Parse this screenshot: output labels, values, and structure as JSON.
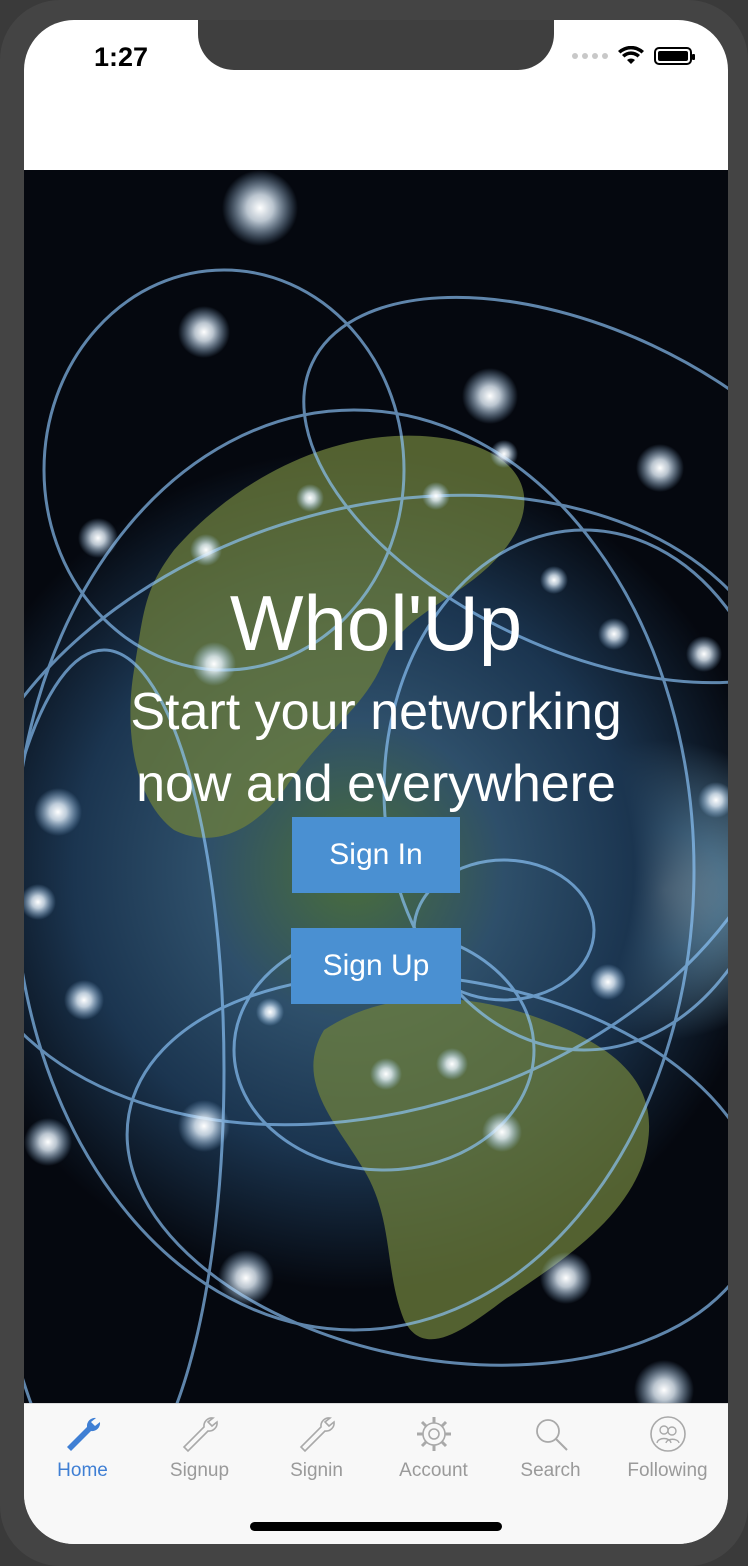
{
  "status_bar": {
    "time": "1:27"
  },
  "hero": {
    "title": "Whol'Up",
    "subtitle_line1": "Start your networking",
    "subtitle_line2": "now and everywhere",
    "signin_label": "Sign In",
    "signup_label": "Sign Up"
  },
  "tabs": [
    {
      "label": "Home",
      "icon": "wrench-icon",
      "active": true
    },
    {
      "label": "Signup",
      "icon": "wrench-icon",
      "active": false
    },
    {
      "label": "Signin",
      "icon": "wrench-icon",
      "active": false
    },
    {
      "label": "Account",
      "icon": "gear-icon",
      "active": false
    },
    {
      "label": "Search",
      "icon": "search-icon",
      "active": false
    },
    {
      "label": "Following",
      "icon": "users-icon",
      "active": false
    }
  ],
  "colors": {
    "accent": "#4a90d2",
    "tab_active": "#3f7fd4",
    "tab_inactive": "#9a9a9a"
  }
}
